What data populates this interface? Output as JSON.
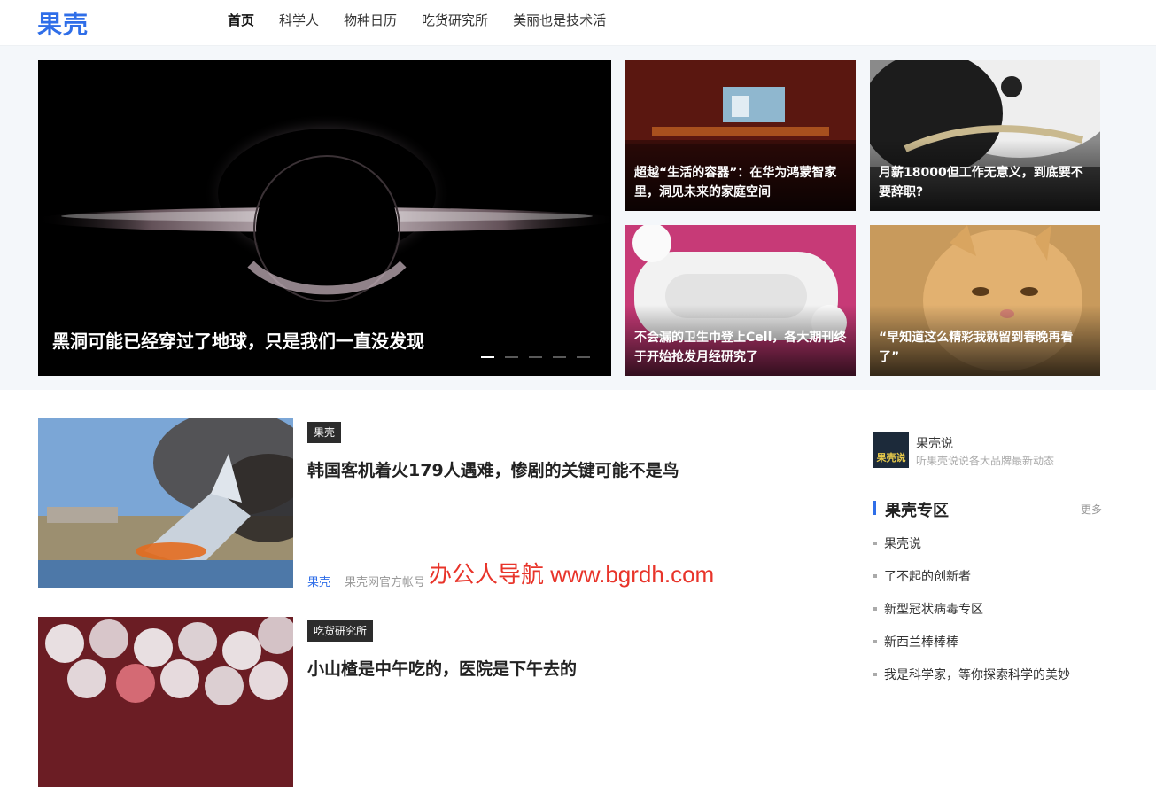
{
  "header": {
    "logo": "果壳",
    "nav": [
      {
        "label": "首页",
        "active": true
      },
      {
        "label": "科学人",
        "active": false
      },
      {
        "label": "物种日历",
        "active": false
      },
      {
        "label": "吃货研究所",
        "active": false
      },
      {
        "label": "美丽也是技术活",
        "active": false
      }
    ]
  },
  "hero": {
    "main_title": "黑洞可能已经穿过了地球，只是我们一直没发现",
    "slides_count": 5,
    "active_slide": 1,
    "cards": [
      {
        "title": "超越“生活的容器”：在华为鸿蒙智家里，洞见未来的家庭空间"
      },
      {
        "title": "月薪18000但工作无意义，到底要不要辞职?"
      },
      {
        "title": "不会漏的卫生巾登上Cell，各大期刊终于开始抢发月经研究了"
      },
      {
        "title": "“早知道这么精彩我就留到春晚再看了”"
      }
    ]
  },
  "articles": [
    {
      "tag": "果壳",
      "title": "韩国客机着火179人遇难，惨剧的关键可能不是鸟",
      "author": "果壳",
      "author_desc": "果壳网官方帐号"
    },
    {
      "tag": "吃货研究所",
      "title": "小山楂是中午吃的，医院是下午去的"
    }
  ],
  "watermark": "办公人导航 www.bgrdh.com",
  "sidebar": {
    "brand_logo": "果壳说",
    "brand_name": "果壳说",
    "brand_desc": "听果壳说说各大品牌最新动态",
    "section_title": "果壳专区",
    "more": "更多",
    "items": [
      {
        "label": "果壳说"
      },
      {
        "label": "了不起的创新者"
      },
      {
        "label": "新型冠状病毒专区"
      },
      {
        "label": "新西兰棒棒棒"
      },
      {
        "label": "我是科学家，等你探索科学的美妙"
      }
    ]
  }
}
